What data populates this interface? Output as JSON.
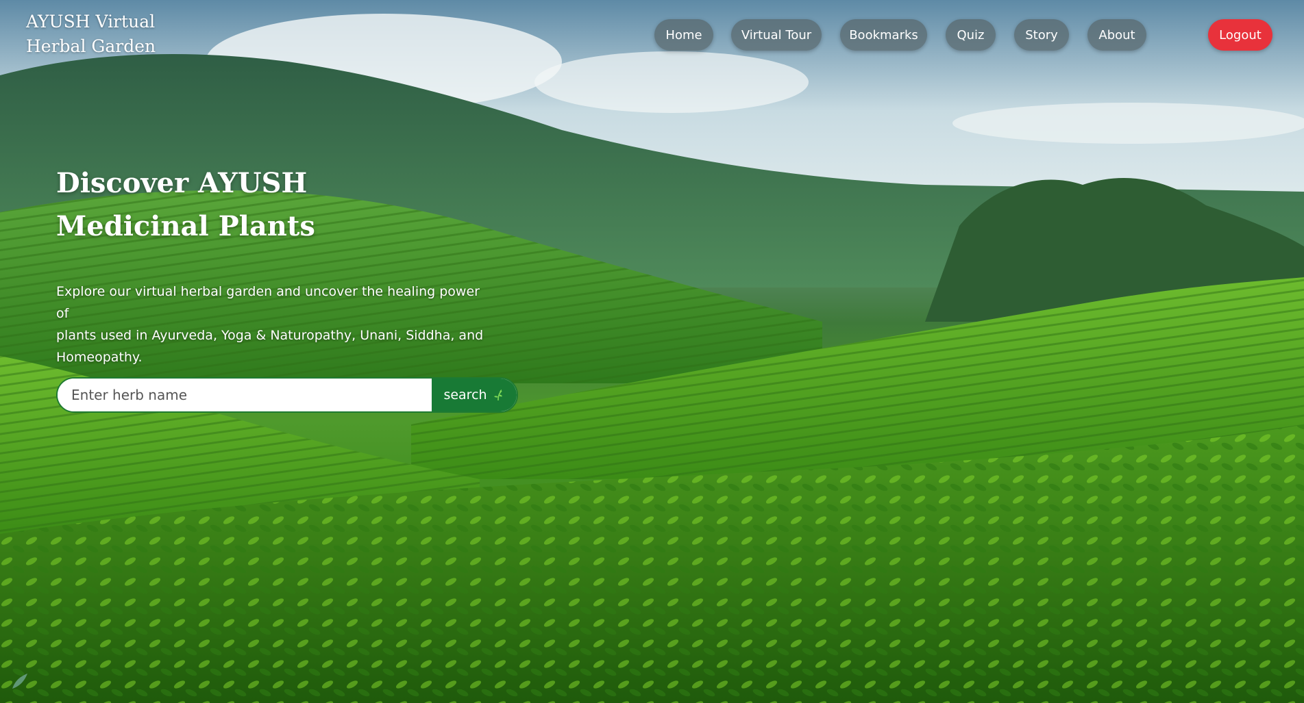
{
  "brand": {
    "line1": "AYUSH Virtual",
    "line2": "Herbal Garden"
  },
  "nav": {
    "home": "Home",
    "virtual_tour": "Virtual Tour",
    "bookmarks": "Bookmarks",
    "quiz": "Quiz",
    "story": "Story",
    "about": "About",
    "logout": "Logout"
  },
  "hero": {
    "title_line1": "Discover AYUSH",
    "title_line2": "Medicinal Plants",
    "lead_line1": "Explore our virtual herbal garden and uncover the healing power of",
    "lead_line2": "plants used in Ayurveda, Yoga & Naturopathy, Unani, Siddha, and",
    "lead_line3": "Homeopathy."
  },
  "search": {
    "placeholder": "Enter herb name",
    "value": "",
    "button_label": "search",
    "button_icon": "leaf-icon"
  },
  "colors": {
    "logout": "#e8323b",
    "search_button": "#187a35",
    "nav_button": "#58686e"
  }
}
